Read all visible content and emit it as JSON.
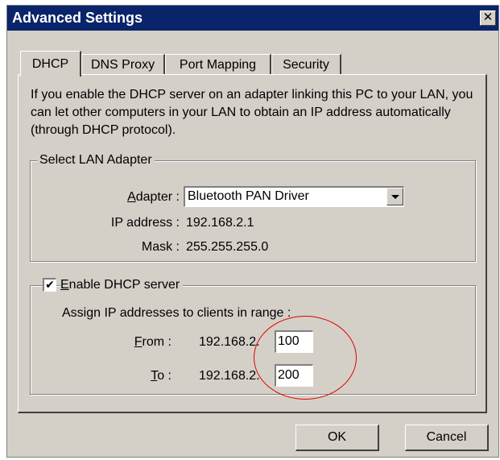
{
  "window": {
    "title": "Advanced Settings",
    "close_glyph": "✕"
  },
  "tabs": [
    {
      "label": "DHCP",
      "active": true
    },
    {
      "label": "DNS Proxy",
      "active": false
    },
    {
      "label": "Port Mapping",
      "active": false
    },
    {
      "label": "Security",
      "active": false
    }
  ],
  "dhcp": {
    "description": "If you enable the DHCP server on an adapter linking this PC to your LAN, you can let other computers in your LAN to obtain an IP address automatically (through DHCP protocol).",
    "lan_group": {
      "label": "Select LAN Adapter",
      "adapter_label_mnemonic": "A",
      "adapter_label_rest": "dapter :",
      "adapter_value": "Bluetooth PAN Driver",
      "ip_label": "IP address :",
      "ip_value": "192.168.2.1",
      "mask_label": "Mask :",
      "mask_value": "255.255.255.0"
    },
    "server_group": {
      "enable_checked": true,
      "check_glyph": "✔",
      "enable_label_mnemonic": "E",
      "enable_label_rest": "nable DHCP server",
      "range_text": "Assign IP addresses to clients in range :",
      "from_label_mnemonic": "F",
      "from_label_rest": "rom :",
      "from_prefix": "192.168.2.",
      "from_value": "100",
      "to_label_mnemonic": "T",
      "to_label_rest": "o :",
      "to_prefix": "192.168.2.",
      "to_value": "200"
    }
  },
  "buttons": {
    "ok": "OK",
    "cancel": "Cancel"
  },
  "colors": {
    "titlebar": "#0a246a",
    "face": "#d4d0c8",
    "annotation": "#e00000"
  }
}
